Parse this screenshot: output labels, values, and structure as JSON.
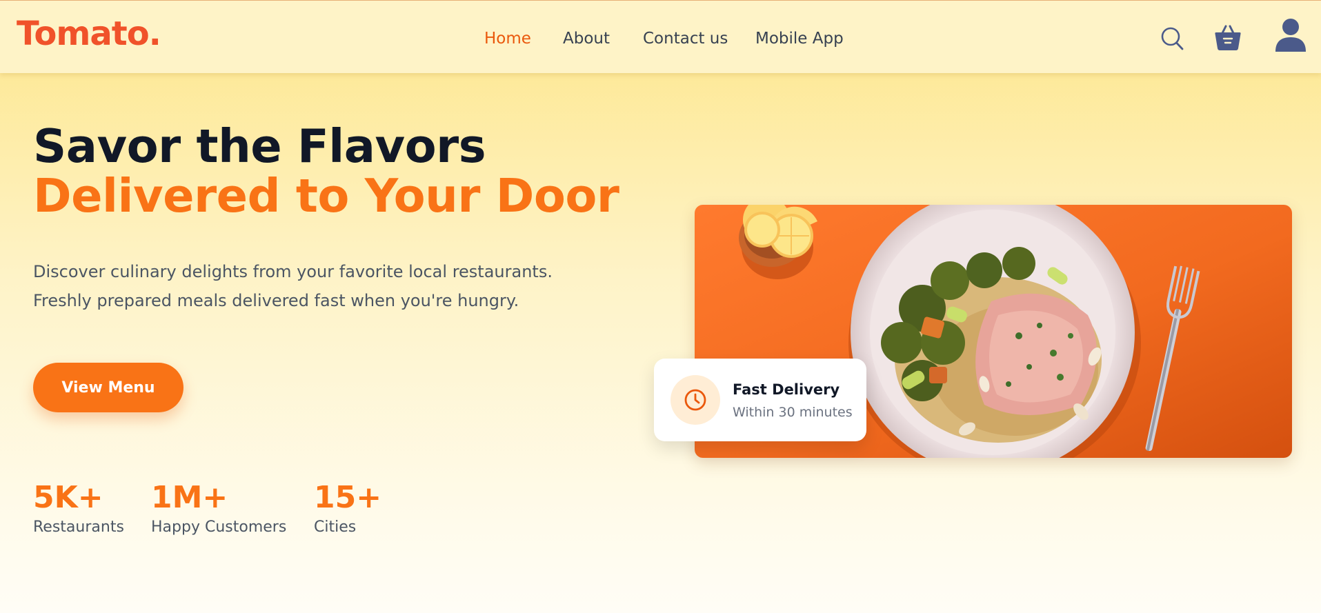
{
  "brand": {
    "logo_text": "Tomato."
  },
  "nav": {
    "links": [
      {
        "label": "Home",
        "active": true
      },
      {
        "label": "About",
        "active": false
      },
      {
        "label": "Contact us",
        "active": false
      },
      {
        "label": "Mobile App",
        "active": false
      }
    ],
    "icons": [
      "search-icon",
      "basket-icon",
      "profile-icon"
    ]
  },
  "hero": {
    "title_line1": "Savor the Flavors",
    "title_line2": "Delivered to Your Door",
    "description_line1": "Discover culinary delights from your favorite local restaurants.",
    "description_line2": "Freshly prepared meals delivered fast when you're hungry.",
    "cta_label": "View Menu"
  },
  "stats": [
    {
      "value": "5K+",
      "label": "Restaurants"
    },
    {
      "value": "1M+",
      "label": "Happy Customers"
    },
    {
      "value": "15+",
      "label": "Cities"
    }
  ],
  "delivery_card": {
    "icon": "clock-icon",
    "title": "Fast Delivery",
    "subtitle": "Within 30 minutes"
  },
  "colors": {
    "brand": "#f0522a",
    "accent": "#f97316",
    "nav_bg": "#fef3c7",
    "icon": "#4b5a8a"
  }
}
